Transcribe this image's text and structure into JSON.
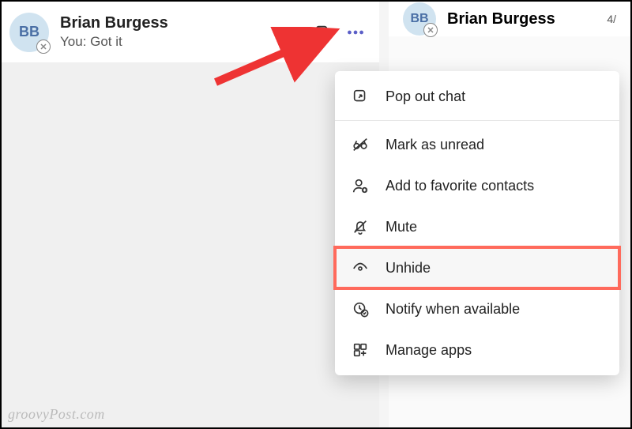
{
  "chat_item": {
    "avatar_initials": "BB",
    "name": "Brian Burgess",
    "preview": "You: Got it"
  },
  "right_header": {
    "avatar_initials": "BB",
    "name": "Brian Burgess",
    "date_fragment": "4/"
  },
  "menu": {
    "popout": "Pop out chat",
    "mark_unread": "Mark as unread",
    "add_favorite": "Add to favorite contacts",
    "mute": "Mute",
    "unhide": "Unhide",
    "notify": "Notify when available",
    "manage_apps": "Manage apps"
  },
  "watermark": "groovyPost.com"
}
